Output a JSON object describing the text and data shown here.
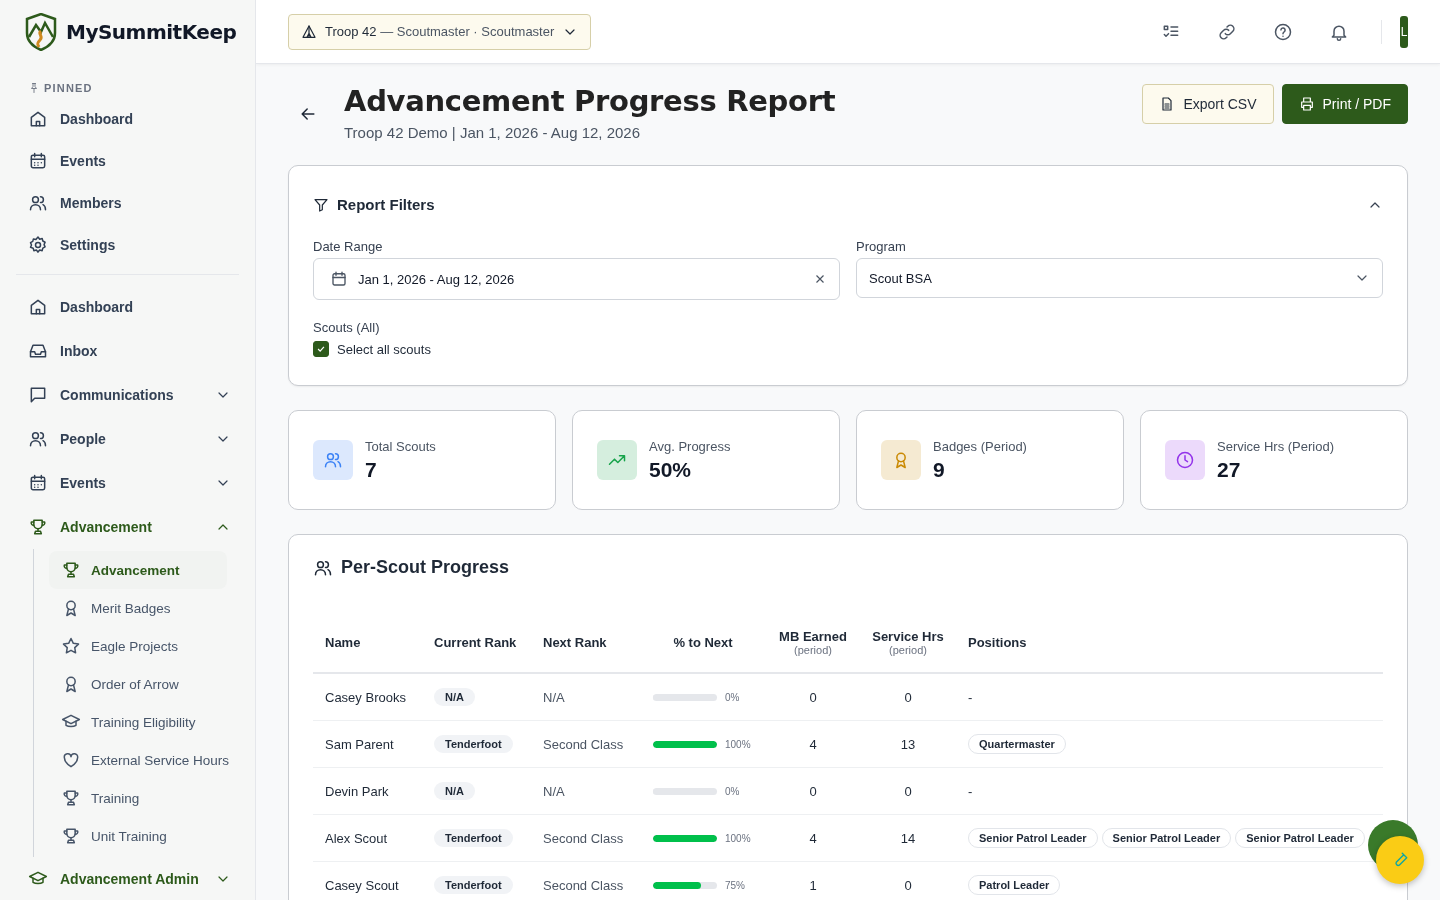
{
  "app": {
    "name": "MySummitKeep"
  },
  "sidebar": {
    "pinned_label": "PINNED",
    "pinned": [
      {
        "label": "Dashboard"
      },
      {
        "label": "Events"
      },
      {
        "label": "Members"
      },
      {
        "label": "Settings"
      }
    ],
    "items": [
      {
        "label": "Dashboard",
        "kind": "link",
        "selected": false
      },
      {
        "label": "Inbox",
        "kind": "link",
        "selected": false
      },
      {
        "label": "Communications",
        "kind": "group",
        "selected": false,
        "expanded": false
      },
      {
        "label": "People",
        "kind": "group",
        "selected": false,
        "expanded": false
      },
      {
        "label": "Events",
        "kind": "group",
        "selected": false,
        "expanded": false
      },
      {
        "label": "Advancement",
        "kind": "group",
        "selected": true,
        "expanded": true,
        "children": [
          {
            "label": "Advancement",
            "selected": true
          },
          {
            "label": "Merit Badges",
            "selected": false
          },
          {
            "label": "Eagle Projects",
            "selected": false
          },
          {
            "label": "Order of Arrow",
            "selected": false
          },
          {
            "label": "Training Eligibility",
            "selected": false
          },
          {
            "label": "External Service Hours",
            "selected": false
          },
          {
            "label": "Training",
            "selected": false
          },
          {
            "label": "Unit Training",
            "selected": false
          }
        ]
      },
      {
        "label": "Advancement Admin",
        "kind": "group",
        "selected": true,
        "expanded": false
      }
    ]
  },
  "topbar": {
    "unit": "Troop 42",
    "role": " — Scoutmaster · Scoutmaster",
    "avatar": "L"
  },
  "header": {
    "title": "Advancement Progress Report",
    "subtitle": "Troop 42 Demo | Jan 1, 2026 - Aug 12, 2026",
    "buttons": [
      {
        "label": "Export CSV",
        "kind": "secondary"
      },
      {
        "label": "Print / PDF",
        "kind": "primary"
      }
    ]
  },
  "filters": {
    "title": "Report Filters",
    "expanded": true,
    "date_range": {
      "label": "Date Range",
      "value": "Jan 1, 2026 - Aug 12, 2026"
    },
    "program": {
      "label": "Program",
      "value": "Scout BSA"
    },
    "scouts": {
      "label": "Scouts (All)",
      "option": "Select all scouts",
      "checked": true
    }
  },
  "stats": [
    {
      "label": "Total Scouts",
      "value": "7",
      "color": "#3b82f6"
    },
    {
      "label": "Avg. Progress",
      "value": "50%",
      "color": "#16a34a"
    },
    {
      "label": "Badges (Period)",
      "value": "9",
      "color": "#ca8a04"
    },
    {
      "label": "Service Hrs (Period)",
      "value": "27",
      "color": "#9333ea"
    }
  ],
  "table": {
    "title": "Per-Scout Progress",
    "columns": [
      {
        "label": "Name"
      },
      {
        "label": "Current Rank"
      },
      {
        "label": "Next Rank"
      },
      {
        "label": "% to Next"
      },
      {
        "label": "MB Earned",
        "sublabel": "(period)"
      },
      {
        "label": "Service Hrs",
        "sublabel": "(period)"
      },
      {
        "label": "Positions"
      }
    ],
    "rows": [
      {
        "name": "Casey Brooks",
        "current_rank": "N/A",
        "next_rank": "N/A",
        "level": 0,
        "percent": "0%",
        "mb_earned": "0",
        "service_hrs": "0",
        "positions_empty": "-"
      },
      {
        "name": "Sam Parent",
        "current_rank": "Tenderfoot",
        "next_rank": "Second Class",
        "level": 1,
        "percent": "100%",
        "mb_earned": "4",
        "service_hrs": "13",
        "positions": [
          "Quartermaster"
        ]
      },
      {
        "name": "Devin Park",
        "current_rank": "N/A",
        "next_rank": "N/A",
        "level": 0,
        "percent": "0%",
        "mb_earned": "0",
        "service_hrs": "0",
        "positions_empty": "-"
      },
      {
        "name": "Alex Scout",
        "current_rank": "Tenderfoot",
        "next_rank": "Second Class",
        "level": 1,
        "percent": "100%",
        "mb_earned": "4",
        "service_hrs": "14",
        "positions": [
          "Senior Patrol Leader",
          "Senior Patrol Leader",
          "Senior Patrol Leader"
        ]
      },
      {
        "name": "Casey Scout",
        "current_rank": "Tenderfoot",
        "next_rank": "Second Class",
        "level": 0.75,
        "percent": "75%",
        "mb_earned": "1",
        "service_hrs": "0",
        "positions": [
          "Patrol Leader"
        ]
      }
    ]
  }
}
